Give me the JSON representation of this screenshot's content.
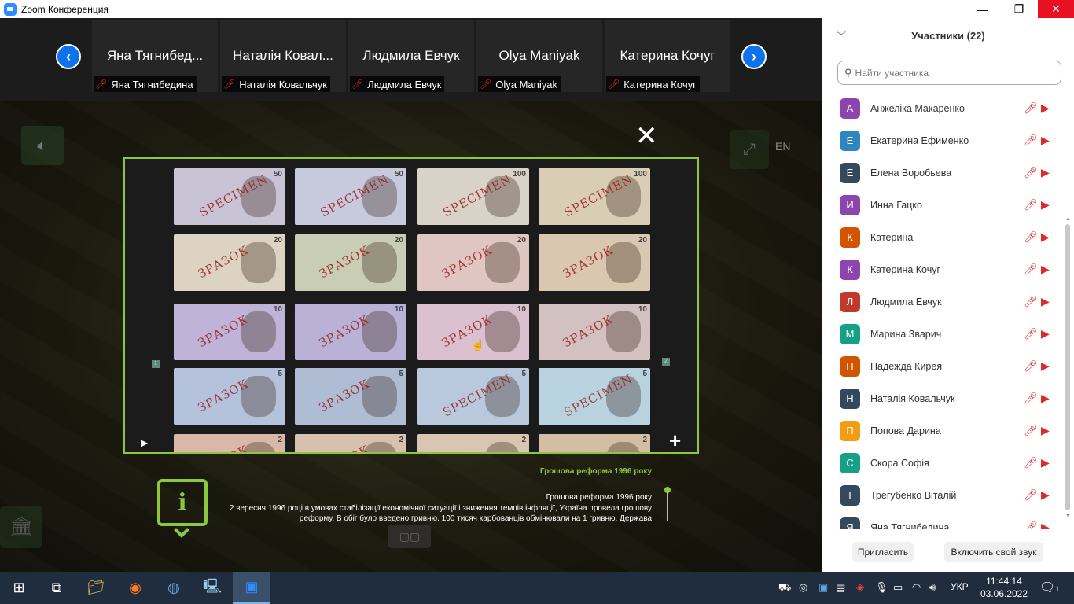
{
  "window": {
    "title": "Zoom Конференция",
    "minimize": "—",
    "maximize": "❐",
    "close": "✕"
  },
  "strip": {
    "prev": "‹",
    "next": "›",
    "tiles": [
      {
        "display": "Яна  Тягнибед...",
        "label": "Яна Тягнибедина"
      },
      {
        "display": "Наталія Ковал...",
        "label": "Наталія Ковальчук"
      },
      {
        "display": "Людмила Евчук",
        "label": "Людмила Евчук"
      },
      {
        "display": "Olya Maniyak",
        "label": "Olya Maniyak"
      },
      {
        "display": "Катерина Кочуг",
        "label": "Катерина Кочуг"
      }
    ]
  },
  "share": {
    "lang": "EN",
    "close": "✕",
    "viewer": {
      "play": "▶",
      "plus": "+",
      "page_left": "1",
      "page_right": "2",
      "notes": [
        {
          "num": "50",
          "stamp": "SPECIMEN",
          "color": "#c9c3d6"
        },
        {
          "num": "50",
          "stamp": "SPECIMEN",
          "color": "#c7c9dd"
        },
        {
          "num": "100",
          "stamp": "SPECIMEN",
          "color": "#d8d2c9"
        },
        {
          "num": "100",
          "stamp": "SPECIMEN",
          "color": "#d9cdb5"
        },
        {
          "num": "20",
          "stamp": "ЗРАЗОК",
          "color": "#ddd3c2"
        },
        {
          "num": "20",
          "stamp": "ЗРАЗОК",
          "color": "#c9cdb4"
        },
        {
          "num": "20",
          "stamp": "ЗРАЗОК",
          "color": "#dfc6c0"
        },
        {
          "num": "20",
          "stamp": "ЗРАЗОК",
          "color": "#d9c7b0"
        },
        {
          "num": "10",
          "stamp": "ЗРАЗОК",
          "color": "#bfb4d8"
        },
        {
          "num": "10",
          "stamp": "ЗРАЗОК",
          "color": "#b9b2d6"
        },
        {
          "num": "10",
          "stamp": "ЗРАЗОК",
          "color": "#dbc1cf"
        },
        {
          "num": "10",
          "stamp": "ЗРАЗОК",
          "color": "#d3c0c0"
        },
        {
          "num": "5",
          "stamp": "ЗРАЗОК",
          "color": "#b4c2dc"
        },
        {
          "num": "5",
          "stamp": "ЗРАЗОК",
          "color": "#aebdd4"
        },
        {
          "num": "5",
          "stamp": "SPECIMEN",
          "color": "#b8c9de"
        },
        {
          "num": "5",
          "stamp": "SPECIMEN",
          "color": "#b9d2e0"
        },
        {
          "num": "2",
          "stamp": "ЗРАЗОК",
          "color": "#d9b8a8"
        },
        {
          "num": "2",
          "stamp": "ЗРАЗОК",
          "color": "#d7c0ae"
        },
        {
          "num": "2",
          "stamp": "",
          "color": "#d8c6b2"
        },
        {
          "num": "2",
          "stamp": "",
          "color": "#d3bda3"
        }
      ]
    },
    "info": {
      "icon": "i",
      "title": "Грошова реформа 1996 року",
      "heading": "Грошова реформа 1996 року",
      "body": "2 вересня 1996 році в умовах стабілізації економічної ситуації і зниження темпів інфляції, Україна провела грошову реформу. В обіг було введено гривню. 100 тисяч карбованців обмінювали на 1 гривню. Держава"
    }
  },
  "panel": {
    "title": "Участники (22)",
    "search_placeholder": "Найти участника",
    "participants": [
      {
        "initial": "А",
        "name": "Анжеліка Макаренко",
        "color": "#8E44AD"
      },
      {
        "initial": "Е",
        "name": "Екатерина Ефименко",
        "color": "#2E86C1"
      },
      {
        "initial": "Е",
        "name": "Елена Воробьева",
        "color": "#34495E"
      },
      {
        "initial": "И",
        "name": "Инна Гацко",
        "color": "#8E44AD"
      },
      {
        "initial": "К",
        "name": "Катерина",
        "color": "#D35400"
      },
      {
        "initial": "К",
        "name": "Катерина Кочуг",
        "color": "#8E44AD"
      },
      {
        "initial": "Л",
        "name": "Людмила Евчук",
        "color": "#C0392B"
      },
      {
        "initial": "М",
        "name": "Марина Зварич",
        "color": "#16A085"
      },
      {
        "initial": "Н",
        "name": "Надежда Кирея",
        "color": "#D35400"
      },
      {
        "initial": "Н",
        "name": "Наталія Ковальчук",
        "color": "#34495E"
      },
      {
        "initial": "П",
        "name": "Попова Дарина",
        "color": "#F39C12"
      },
      {
        "initial": "С",
        "name": "Скора Софія",
        "color": "#16A085"
      },
      {
        "initial": "Т",
        "name": "Трегубенко Віталій",
        "color": "#34495E"
      },
      {
        "initial": "Я",
        "name": "Яна Тягнибедина",
        "color": "#34495E"
      }
    ],
    "invite": "Пригласить",
    "unmute": "Включить свой звук"
  },
  "taskbar": {
    "lang": "УКР",
    "time": "11:44:14",
    "date": "03.06.2022",
    "notifications": "1"
  }
}
